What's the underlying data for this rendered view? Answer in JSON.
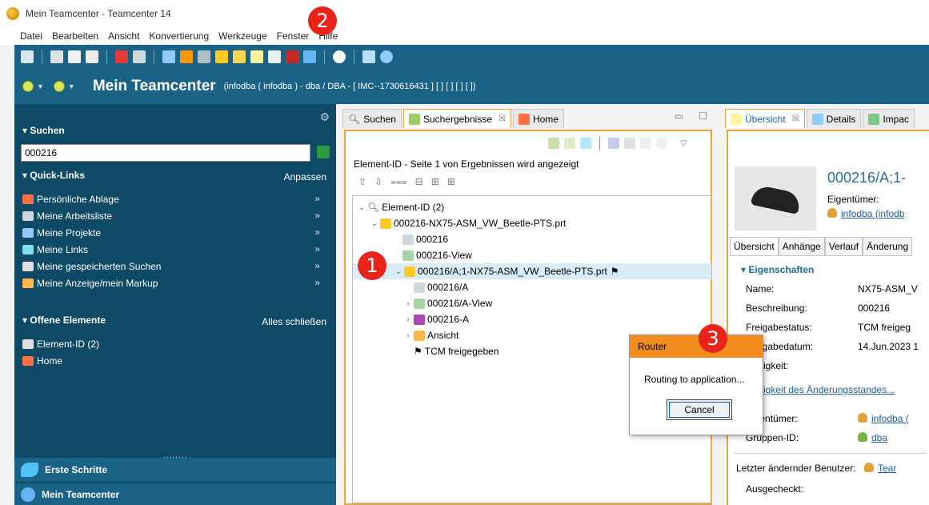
{
  "window": {
    "title": "Mein Teamcenter - Teamcenter 14"
  },
  "menu": [
    "Datei",
    "Bearbeiten",
    "Ansicht",
    "Konvertierung",
    "Werkzeuge",
    "Fenster",
    "Hilfe"
  ],
  "header": {
    "title": "Mein Teamcenter",
    "subtitle": "(infodba ( infodba ) - dba / DBA - [ IMC--1730616431 ] [ ] [ ] [ ] [ ])"
  },
  "left": {
    "search_label": "Suchen",
    "search_value": "000216",
    "quick_links_label": "Quick-Links",
    "quick_links_action": "Anpassen",
    "quick_links": [
      "Persönliche Ablage",
      "Meine Arbeitsliste",
      "Meine Projekte",
      "Meine Links",
      "Meine gespeicherten Suchen",
      "Meine Anzeige/mein Markup"
    ],
    "chevron": "»",
    "open_label": "Offene Elemente",
    "open_action": "Alles schließen",
    "open_items": [
      "Element-ID (2)",
      "Home"
    ],
    "bottom1": "Erste Schritte",
    "bottom2": "Mein Teamcenter",
    "dots": "........"
  },
  "mid": {
    "tabs": [
      "Suchen",
      "Suchergebnisse",
      "Home"
    ],
    "tab_close": "☒",
    "results_label": "Element-ID - Seite 1 von Ergebnissen wird angezeigt",
    "tree": [
      "Element-ID (2)",
      "000216-NX75-ASM_VW_Beetle-PTS.prt",
      "000216",
      "000216-View",
      "000216/A;1-NX75-ASM_VW_Beetle-PTS.prt",
      "000216/A",
      "000216/A-View",
      "000216-A",
      "Ansicht",
      "TCM freigegeben"
    ]
  },
  "right": {
    "tabs": [
      "Übersicht",
      "Details",
      "Impac"
    ],
    "title": "000216/A;1-",
    "owner_label": "Eigentümer:",
    "owner_value": "infodba (infodb",
    "subtabs": [
      "Übersicht",
      "Anhänge",
      "Verlauf",
      "Änderung"
    ],
    "section": "Eigenschaften",
    "props": [
      {
        "label": "Name:",
        "value": "NX75-ASM_V"
      },
      {
        "label": "Beschreibung:",
        "value": "000216"
      },
      {
        "label": "Freigabestatus:",
        "value": "TCM freigeg"
      },
      {
        "label": "Freigabedatum:",
        "value": "14.Jun.2023 1"
      },
      {
        "label": "Gültigkeit:",
        "value": ""
      }
    ],
    "link_text": "Gültigkeit des Änderungsstandes...",
    "props2": [
      {
        "label": "Eigentümer:",
        "value": "infodba ("
      },
      {
        "label": "Gruppen-ID:",
        "value": "dba"
      }
    ],
    "last_user_label": "Letzter ändernder Benutzer:",
    "last_user_value": "Tear",
    "checkout_label": "Ausgecheckt:"
  },
  "dialog": {
    "title": "Router",
    "message": "Routing to application...",
    "button": "Cancel"
  },
  "markers": [
    "1",
    "2",
    "3"
  ],
  "colors": {
    "teal_dark": "#0e4a66",
    "teal": "#1b6386",
    "orange": "#e7a53b",
    "dialog_header": "#f28c1c",
    "marker_red": "#e8231a"
  }
}
